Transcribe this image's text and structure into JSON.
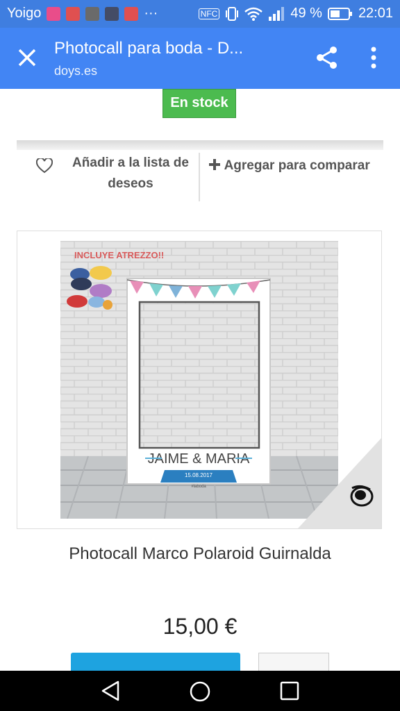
{
  "status_bar": {
    "carrier": "Yoigo",
    "overflow": "···",
    "battery_percent": "49 %",
    "time": "22:01",
    "icons": [
      "music-app-icon",
      "notification-app-icon",
      "gallery-app-icon",
      "image-app-icon",
      "notification-app-icon-2",
      "nfc-icon",
      "vibrate-icon",
      "wifi-icon",
      "signal-icon",
      "battery-icon"
    ]
  },
  "toolbar": {
    "title": "Photocall para boda - D...",
    "url": "doys.es",
    "icons": [
      "close-icon",
      "share-icon",
      "more-vert-icon"
    ]
  },
  "product": {
    "stock_label": "En stock",
    "wishlist_label": "Añadir a la lista de deseos",
    "compare_label": "Agregar para comparar",
    "image": {
      "header_text": "INCLUYE ATREZZO!!",
      "names": "JAIME & MARIA",
      "date": "15.08.2017",
      "hashtag": "#laboda"
    },
    "name": "Photocall Marco Polaroid Guirnalda",
    "price": "15,00 €"
  },
  "colors": {
    "status_bar": "#3f7ee0",
    "toolbar": "#4285f4",
    "stock_badge": "#4cbb4f",
    "add_to_cart": "#1ea3e0"
  }
}
